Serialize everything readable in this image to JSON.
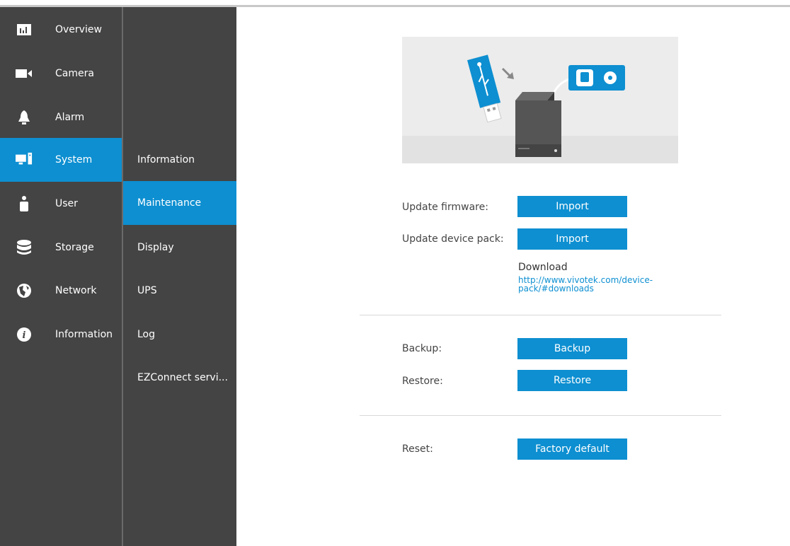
{
  "nav_primary": {
    "items": [
      {
        "label": "Overview",
        "icon": "overview-icon"
      },
      {
        "label": "Camera",
        "icon": "camera-icon"
      },
      {
        "label": "Alarm",
        "icon": "alarm-bell-icon"
      },
      {
        "label": "System",
        "icon": "system-icon",
        "active": true
      },
      {
        "label": "User",
        "icon": "user-icon"
      },
      {
        "label": "Storage",
        "icon": "storage-icon"
      },
      {
        "label": "Network",
        "icon": "network-icon"
      },
      {
        "label": "Information",
        "icon": "info-icon"
      }
    ]
  },
  "nav_secondary": {
    "items": [
      {
        "label": "Information"
      },
      {
        "label": "Maintenance",
        "active": true
      },
      {
        "label": "Display"
      },
      {
        "label": "UPS"
      },
      {
        "label": "Log"
      },
      {
        "label": "EZConnect servi..."
      }
    ]
  },
  "maintenance": {
    "update_firmware": {
      "label": "Update firmware:",
      "button": "Import"
    },
    "update_device_pack": {
      "label": "Update device pack:",
      "button": "Import"
    },
    "download": {
      "title": "Download",
      "link_line1": "http://www.vivotek.com/device-",
      "link_line2": "pack/#downloads"
    },
    "backup": {
      "label": "Backup:",
      "button": "Backup"
    },
    "restore": {
      "label": "Restore:",
      "button": "Restore"
    },
    "reset": {
      "label": "Reset:",
      "button": "Factory default"
    }
  },
  "colors": {
    "accent": "#0d8fd1",
    "sidebar_bg": "#444444",
    "illustration_bg": "#ececec"
  }
}
